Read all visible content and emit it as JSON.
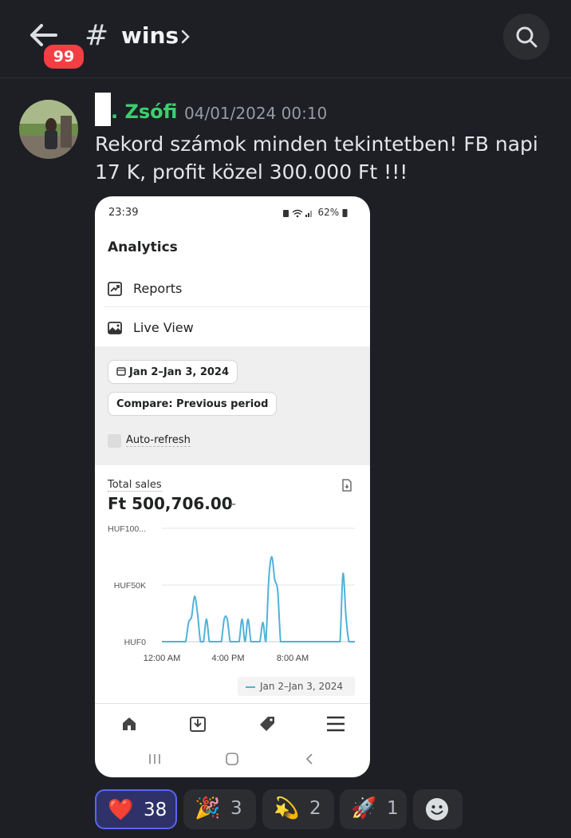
{
  "header": {
    "unread_badge": "99",
    "channel_name": "wins"
  },
  "message": {
    "author": ". Zsófi",
    "timestamp": "04/01/2024 00:10",
    "text": "Rekord számok minden tekintetben! FB napi 17 K, profit közel 300.000 Ft !!!"
  },
  "phone": {
    "time": "23:39",
    "battery": "62%",
    "section_title": "Analytics",
    "nav_items": [
      {
        "label": "Reports",
        "icon": "reports-icon"
      },
      {
        "label": "Live View",
        "icon": "live-view-icon"
      }
    ],
    "date_range": "Jan 2–Jan 3, 2024",
    "compare": "Compare: Previous period",
    "auto_refresh": "Auto-refresh",
    "total_sales_label": "Total sales",
    "total_sales_value": "Ft 500,706.00",
    "total_sales_change": "–",
    "legend": "Jan 2–Jan 3, 2024",
    "bottom_tabs": [
      "home-icon",
      "orders-icon",
      "products-icon",
      "menu-icon"
    ]
  },
  "chart_data": {
    "type": "line",
    "title": "",
    "xlabel": "",
    "ylabel": "",
    "y_tick_labels": [
      "HUF0",
      "HUF50K",
      "HUF100..."
    ],
    "x_tick_labels": [
      "12:00 AM",
      "4:00 PM",
      "8:00 AM"
    ],
    "ylim": [
      0,
      100000
    ],
    "series": [
      {
        "name": "Jan 2–Jan 3, 2024",
        "color": "#4fb3d9",
        "x": [
          0,
          1,
          2,
          3,
          4,
          5,
          6,
          7,
          8,
          9,
          10,
          11,
          12,
          13,
          14,
          15,
          16,
          17,
          18,
          19,
          20,
          21,
          22,
          23,
          24,
          25,
          26,
          27,
          28,
          29,
          30,
          31,
          32,
          33,
          34,
          35,
          36,
          37,
          38,
          39,
          40,
          41,
          42,
          43,
          44,
          45,
          46,
          47,
          48,
          49,
          50,
          51,
          52,
          53,
          54,
          55,
          56,
          57,
          58,
          59,
          60,
          61,
          62,
          63,
          64,
          65
        ],
        "values": [
          0,
          0,
          0,
          0,
          0,
          0,
          0,
          0,
          0,
          17000,
          22000,
          40000,
          25000,
          0,
          0,
          20000,
          0,
          0,
          0,
          0,
          0,
          20000,
          20000,
          0,
          0,
          0,
          0,
          20000,
          0,
          20000,
          0,
          0,
          0,
          0,
          17000,
          0,
          55000,
          75000,
          55000,
          45000,
          0,
          0,
          0,
          0,
          0,
          0,
          0,
          0,
          0,
          0,
          0,
          0,
          0,
          0,
          0,
          0,
          0,
          0,
          0,
          0,
          0,
          60000,
          22000,
          0,
          0,
          0
        ]
      }
    ],
    "grid": true
  },
  "reactions": [
    {
      "emoji": "❤️",
      "count": "38",
      "mine": true
    },
    {
      "emoji": "🎉",
      "count": "3",
      "mine": false
    },
    {
      "emoji": "💫",
      "count": "2",
      "mine": false
    },
    {
      "emoji": "🚀",
      "count": "1",
      "mine": false
    }
  ],
  "colors": {
    "background": "#1e1f25",
    "username": "#3ccf6e",
    "badge": "#f23f43",
    "accent": "#5865f2"
  }
}
